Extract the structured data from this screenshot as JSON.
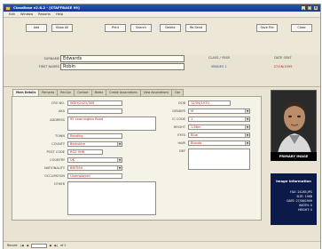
{
  "window": {
    "title": "ClassBase v2.8.2 - [STAFFBASE 99]"
  },
  "menu": [
    "Edit",
    "Window",
    "Reports",
    "Help"
  ],
  "toolbar": {
    "buttons": [
      {
        "label": "Add",
        "name": "add-button"
      },
      {
        "label": "Show All",
        "name": "show-all-button"
      },
      {
        "label": "Print",
        "name": "print-button"
      },
      {
        "label": "Search",
        "name": "search-button"
      },
      {
        "label": "Delete",
        "name": "delete-button"
      },
      {
        "label": "Re-Send",
        "name": "resend-button"
      },
      {
        "label": "Save File",
        "name": "save-file-button"
      },
      {
        "label": "Close",
        "name": "close-button"
      }
    ]
  },
  "header": {
    "surname_label": "SURNAME",
    "surname": "Edwards",
    "first_names_label": "FIRST NAMES",
    "first_names": "Robin",
    "class_label": "CLASS / YEAR",
    "class_value": "IMAGES 1",
    "date_label": "DATE SENT",
    "date_value": "27/06/1999"
  },
  "tabs": [
    "Main Details",
    "Remarks",
    "RecCon",
    "Contact",
    "Media",
    "Create Associations",
    "View Associations",
    "Opt"
  ],
  "form_left": {
    "fields": [
      {
        "label": "CRO NO.",
        "value": "WDH/2425/306",
        "name": "cro-no-field"
      },
      {
        "label": "AKA",
        "value": "",
        "name": "aka-field"
      },
      {
        "label": "ADDRESS",
        "value": "99 Leamington Road",
        "name": "address-field"
      },
      {
        "label": "TOWN",
        "value": "Reading",
        "name": "town-field"
      },
      {
        "label": "COUNTY",
        "value": "Berkshire",
        "name": "county-field"
      },
      {
        "label": "POST CODE",
        "value": "RG2 5HN",
        "name": "post-code-field"
      },
      {
        "label": "COUNTRY",
        "value": "UK",
        "name": "country-field"
      },
      {
        "label": "NATIONALITY",
        "value": "BRITISH",
        "name": "nationality-field"
      },
      {
        "label": "OCCUPATION",
        "value": "Unemployed",
        "name": "occupation-field"
      },
      {
        "label": "OTHER",
        "value": "",
        "name": "other-field"
      }
    ]
  },
  "form_right": {
    "fields": [
      {
        "label": "DOB",
        "value": "12/04/1970",
        "name": "dob-field"
      },
      {
        "label": "GENDER",
        "value": "M",
        "name": "gender-field"
      },
      {
        "label": "IC CODE",
        "value": "1",
        "name": "ic-code-field"
      },
      {
        "label": "HEIGHT",
        "value": "1.86m",
        "name": "height-field"
      },
      {
        "label": "EYES",
        "value": "Blue",
        "name": "eyes-field"
      },
      {
        "label": "HAIR",
        "value": "Blonde",
        "name": "hair-field"
      },
      {
        "label": "DEF",
        "value": "",
        "name": "def-field"
      }
    ]
  },
  "image": {
    "caption": "PRIMARY IMAGE",
    "info_title": "Image Information",
    "info_rows": [
      "FILE: 24285.JPG",
      "SIZE: 19KB",
      "DATE: 27/06/1999",
      "WIDTH: 0",
      "HEIGHT: 0"
    ]
  },
  "status": {
    "record_label": "Record:",
    "record_of": "of 1"
  }
}
